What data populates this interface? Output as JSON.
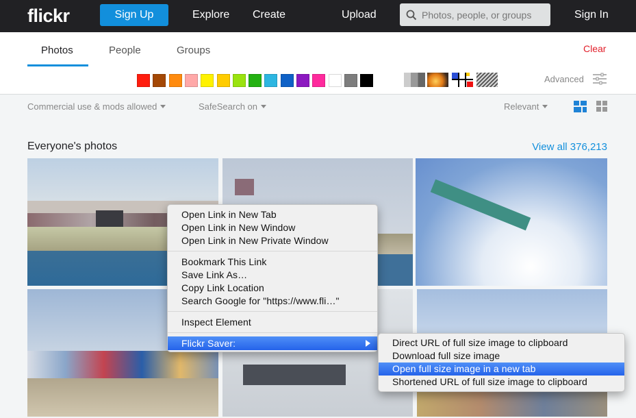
{
  "header": {
    "logo": "flickr",
    "signup_label": "Sign Up",
    "explore_label": "Explore",
    "create_label": "Create",
    "upload_label": "Upload",
    "search_placeholder": "Photos, people, or groups",
    "signin_label": "Sign In"
  },
  "search_tabs": {
    "tabs": [
      {
        "label": "Photos",
        "active": true
      },
      {
        "label": "People",
        "active": false
      },
      {
        "label": "Groups",
        "active": false
      }
    ],
    "clear_label": "Clear",
    "advanced_label": "Advanced"
  },
  "colors": [
    "#ff1d0e",
    "#a44805",
    "#ff8b0f",
    "#ffa8a8",
    "#fff200",
    "#ffcc00",
    "#9ae30f",
    "#24b112",
    "#2db6e1",
    "#0f61c6",
    "#8c19c0",
    "#ff2a9d",
    "#ffffff",
    "#7d7d7d",
    "#000000"
  ],
  "styles": [
    "black-and-white",
    "shallow-depth-of-field",
    "minimalist",
    "patterns"
  ],
  "filters": {
    "license": "Commercial use & mods allowed",
    "safesearch": "SafeSearch on",
    "sort": "Relevant"
  },
  "section": {
    "title": "Everyone's photos",
    "view_all": "View all 376,213"
  },
  "context_menu": {
    "group1": [
      "Open Link in New Tab",
      "Open Link in New Window",
      "Open Link in New Private Window"
    ],
    "group2": [
      "Bookmark This Link",
      "Save Link As…",
      "Copy Link Location",
      "Search Google for \"https://www.fli…\""
    ],
    "group3": [
      "Inspect Element"
    ],
    "group4": [
      "Flickr Saver:"
    ]
  },
  "submenu": {
    "items": [
      "Direct URL of full size image to clipboard",
      "Download full size image",
      "Open full size image in a new tab",
      "Shortened URL of full size image to clipboard"
    ],
    "highlighted_index": 2
  },
  "accent_colors": {
    "nav_bg": "#212124",
    "brand_blue": "#128fdc",
    "clear_red": "#e21f2a",
    "menu_highlight": "#2f6cf0"
  }
}
